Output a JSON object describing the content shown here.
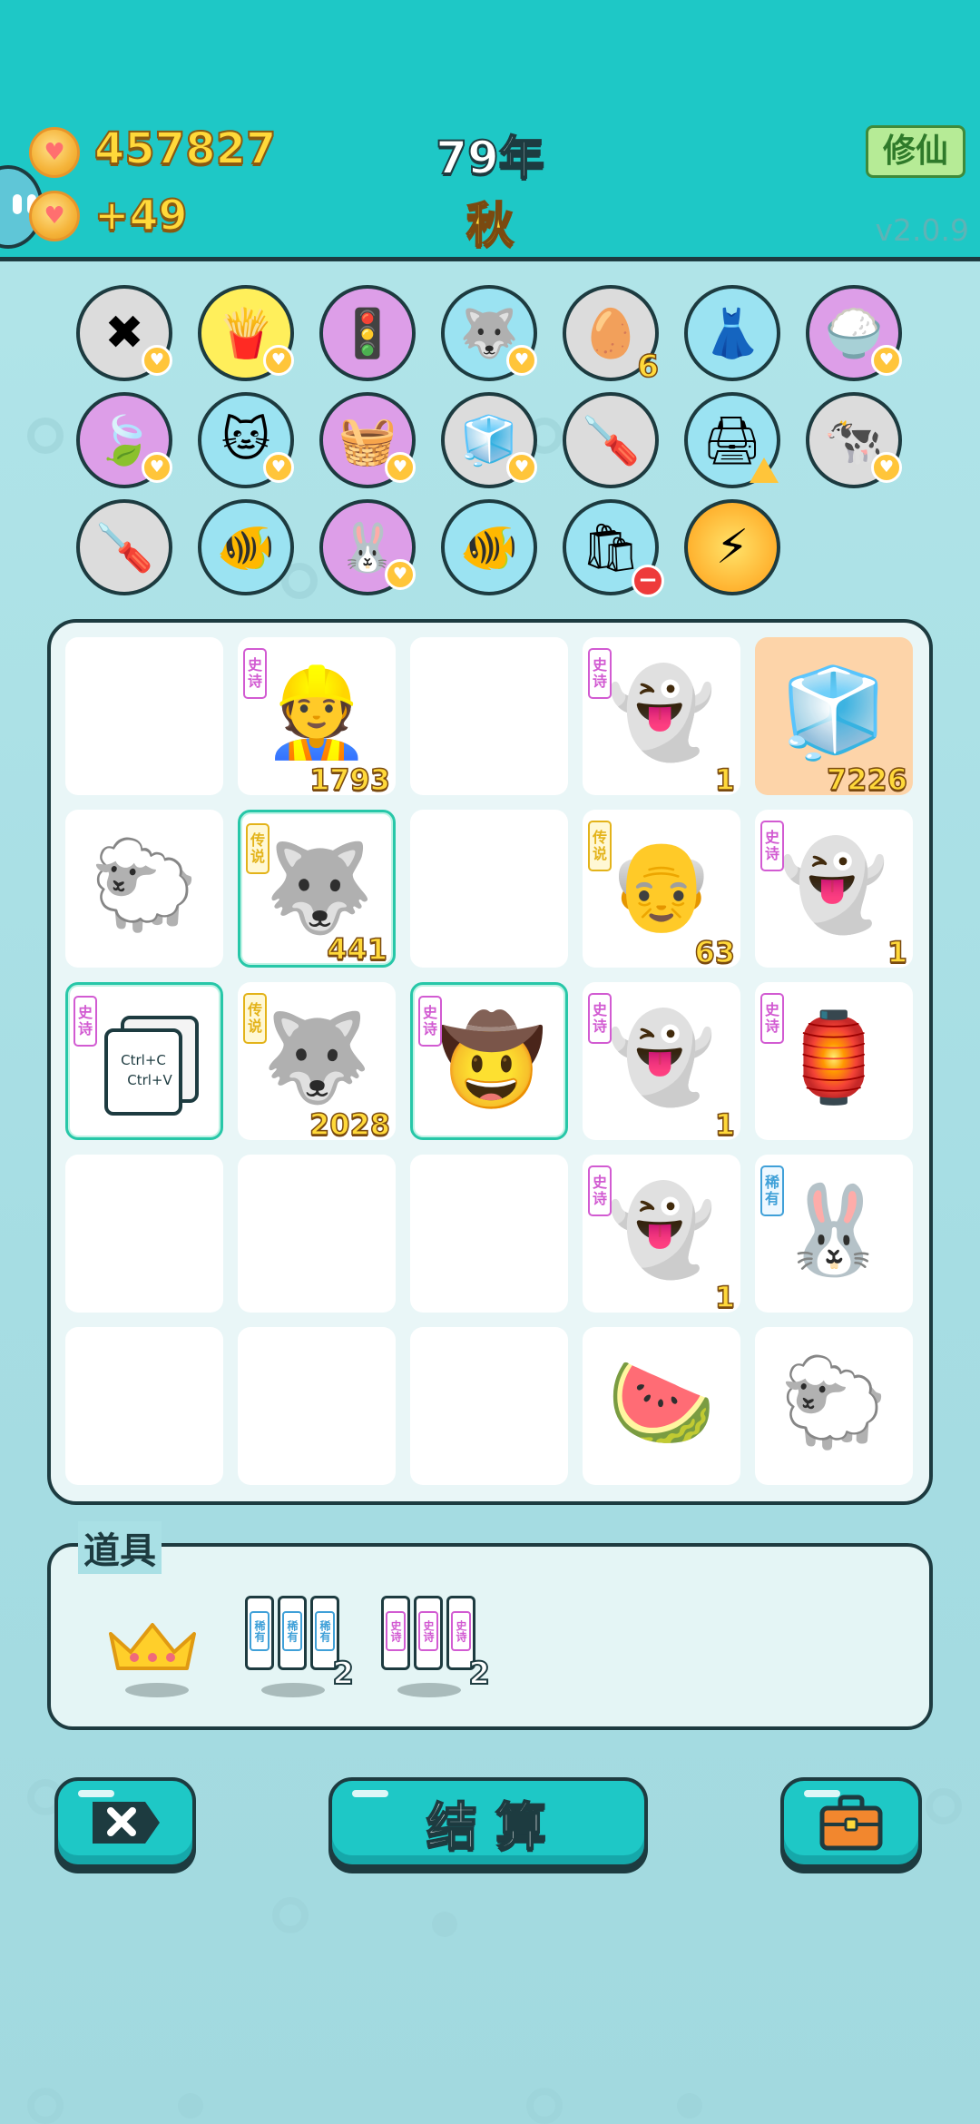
{
  "header": {
    "money": "457827",
    "income": "+49",
    "year": "79年",
    "season": "秋",
    "xiuxian_label": "修仙",
    "version": "v2.0.9"
  },
  "items": [
    {
      "icon": "remove-tag-icon",
      "bg": "gray",
      "glyph": "✖",
      "badge": "heart"
    },
    {
      "icon": "french-fries-icon",
      "bg": "yellow",
      "glyph": "🍟",
      "badge": "heart"
    },
    {
      "icon": "traffic-light-ghost-icon",
      "bg": "purple",
      "glyph": "🚦",
      "badge": ""
    },
    {
      "icon": "husky-dog-icon",
      "bg": "blue",
      "glyph": "🐺",
      "badge": "heart"
    },
    {
      "icon": "egg-carton-icon",
      "bg": "gray",
      "glyph": "🥚",
      "badge": "num",
      "num": "6"
    },
    {
      "icon": "pleated-skirt-icon",
      "bg": "blue",
      "glyph": "👗",
      "badge": ""
    },
    {
      "icon": "rice-bowl-icon",
      "bg": "purple",
      "glyph": "🍚",
      "badge": "heart"
    },
    {
      "icon": "leaf-icon",
      "bg": "purple",
      "glyph": "🍃",
      "badge": "heart"
    },
    {
      "icon": "cat-scratching-post-icon",
      "bg": "blue",
      "glyph": "🐱",
      "badge": "heart"
    },
    {
      "icon": "fruit-basket-icon",
      "bg": "purple",
      "glyph": "🧺",
      "badge": "heart"
    },
    {
      "icon": "sugar-cubes-icon",
      "bg": "gray",
      "glyph": "🧊",
      "badge": "heart"
    },
    {
      "icon": "screwdriver-icon",
      "bg": "gray",
      "glyph": "🪛",
      "badge": ""
    },
    {
      "icon": "printer-icon",
      "bg": "blue",
      "glyph": "🖨",
      "badge": "warn"
    },
    {
      "icon": "cow-pair-icon",
      "bg": "gray",
      "glyph": "🐄",
      "badge": "heart"
    },
    {
      "icon": "screwdriver-icon",
      "bg": "gray",
      "glyph": "🪛",
      "badge": ""
    },
    {
      "icon": "fish-bowl-icon",
      "bg": "blue",
      "glyph": "🐠",
      "badge": ""
    },
    {
      "icon": "bunny-icon",
      "bg": "purple",
      "glyph": "🐰",
      "badge": "heart"
    },
    {
      "icon": "fish-bowl-icon",
      "bg": "blue",
      "glyph": "🐠",
      "badge": ""
    },
    {
      "icon": "trash-bag-icon",
      "bg": "blue",
      "glyph": "🛍",
      "badge": "minus"
    },
    {
      "icon": "lightning-icon",
      "bg": "orange",
      "glyph": "⚡",
      "badge": ""
    }
  ],
  "board": [
    {
      "glyph": "",
      "tag": "",
      "count": "",
      "icon": "empty"
    },
    {
      "glyph": "👷",
      "tag": "史诗",
      "tagType": "epic",
      "count": "1793",
      "icon": "bearded-worker-icon"
    },
    {
      "glyph": "",
      "tag": "",
      "count": "",
      "icon": "empty"
    },
    {
      "glyph": "👻",
      "tag": "史诗",
      "tagType": "epic",
      "count": "1",
      "icon": "ghost-icon"
    },
    {
      "glyph": "🧊",
      "tag": "",
      "count": "7226",
      "icon": "fridge-icon",
      "orange": true
    },
    {
      "glyph": "🐑",
      "tag": "",
      "count": "",
      "icon": "sheep-icon"
    },
    {
      "glyph": "🐺",
      "tag": "传说",
      "tagType": "legend",
      "count": "441",
      "icon": "king-husky-icon",
      "hl": true
    },
    {
      "glyph": "",
      "tag": "",
      "count": "",
      "icon": "empty"
    },
    {
      "glyph": "👴",
      "tag": "传说",
      "tagType": "legend",
      "count": "63",
      "icon": "bald-grandpa-icon"
    },
    {
      "glyph": "👻",
      "tag": "史诗",
      "tagType": "epic",
      "count": "1",
      "icon": "ghost-icon"
    },
    {
      "glyph": "📋",
      "tag": "史诗",
      "tagType": "epic",
      "count": "",
      "icon": "copy-paste-icon",
      "hl": true,
      "copy": true,
      "copy1": "Ctrl+C",
      "copy2": "Ctrl+V"
    },
    {
      "glyph": "🐺",
      "tag": "传说",
      "tagType": "legend",
      "count": "2028",
      "icon": "king-husky-icon"
    },
    {
      "glyph": "🤠",
      "tag": "史诗",
      "tagType": "epic",
      "count": "",
      "icon": "old-farmer-icon",
      "hl": true
    },
    {
      "glyph": "👻",
      "tag": "史诗",
      "tagType": "epic",
      "count": "1",
      "icon": "ghost-icon"
    },
    {
      "glyph": "🏮",
      "tag": "史诗",
      "tagType": "epic",
      "count": "",
      "icon": "bunny-house-icon"
    },
    {
      "glyph": "",
      "tag": "",
      "count": "",
      "icon": "empty"
    },
    {
      "glyph": "",
      "tag": "",
      "count": "",
      "icon": "empty"
    },
    {
      "glyph": "",
      "tag": "",
      "count": "",
      "icon": "empty"
    },
    {
      "glyph": "👻",
      "tag": "史诗",
      "tagType": "epic",
      "count": "1",
      "icon": "ghost-icon"
    },
    {
      "glyph": "🐰",
      "tag": "稀有",
      "tagType": "rare",
      "count": "",
      "icon": "lucky-bunny-icon"
    },
    {
      "glyph": "",
      "tag": "",
      "count": "",
      "icon": "empty"
    },
    {
      "glyph": "",
      "tag": "",
      "count": "",
      "icon": "empty"
    },
    {
      "glyph": "",
      "tag": "",
      "count": "",
      "icon": "empty"
    },
    {
      "glyph": "🍉",
      "tag": "",
      "count": "",
      "icon": "watermelon-icon"
    },
    {
      "glyph": "🐑",
      "tag": "",
      "count": "",
      "icon": "sheep-icon"
    }
  ],
  "props": {
    "title": "道具",
    "items": [
      {
        "icon": "crown-icon",
        "count": ""
      },
      {
        "icon": "rare-cards-icon",
        "count": "2",
        "card_label": "稀有"
      },
      {
        "icon": "epic-cards-icon",
        "count": "2",
        "card_label": "史诗"
      }
    ]
  },
  "buttons": {
    "settle": "结算"
  },
  "colors": {
    "header": "#1ec8c6",
    "outline": "#1d3b40",
    "gold": "#ffd93a"
  }
}
